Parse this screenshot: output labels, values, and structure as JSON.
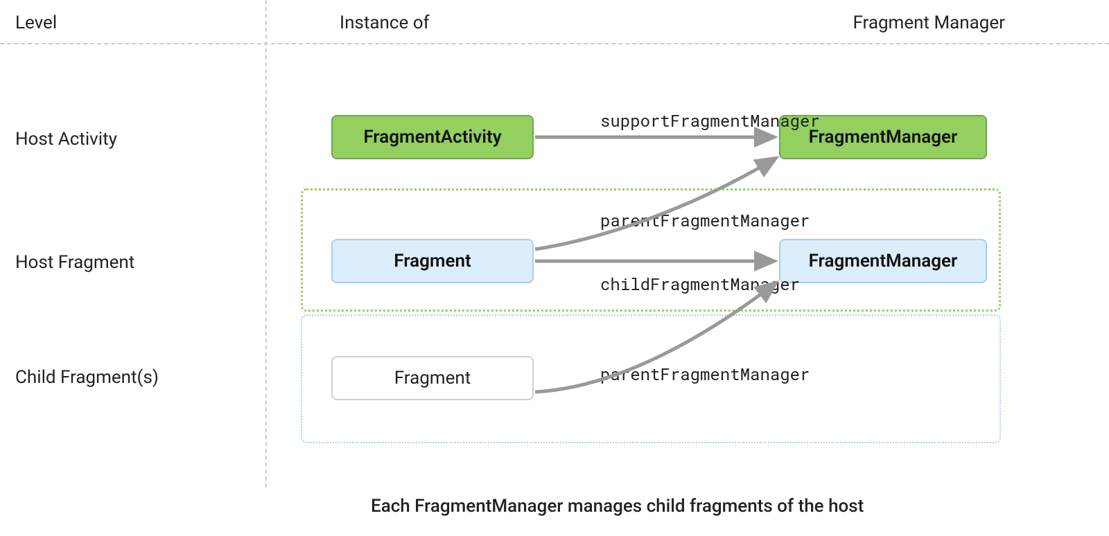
{
  "headers": {
    "level": "Level",
    "instance_of": "Instance of",
    "fragment_manager": "Fragment Manager"
  },
  "levels": {
    "host_activity": "Host Activity",
    "host_fragment": "Host Fragment",
    "child_fragments": "Child Fragment(s)"
  },
  "boxes": {
    "fragment_activity": "FragmentActivity",
    "fragment_manager_top": "FragmentManager",
    "fragment_mid": "Fragment",
    "fragment_manager_mid": "FragmentManager",
    "fragment_child": "Fragment"
  },
  "edges": {
    "support_fm": "supportFragmentManager",
    "parent_fm_1": "parentFragmentManager",
    "child_fm": "childFragmentManager",
    "parent_fm_2": "parentFragmentManager"
  },
  "footnote": "Each FragmentManager manages child fragments of the host",
  "colors": {
    "green_fill": "#93d060",
    "green_border": "#6fa84a",
    "blue_fill": "#dceefb",
    "blue_border": "#a6cfe8",
    "arrow": "#999999"
  }
}
